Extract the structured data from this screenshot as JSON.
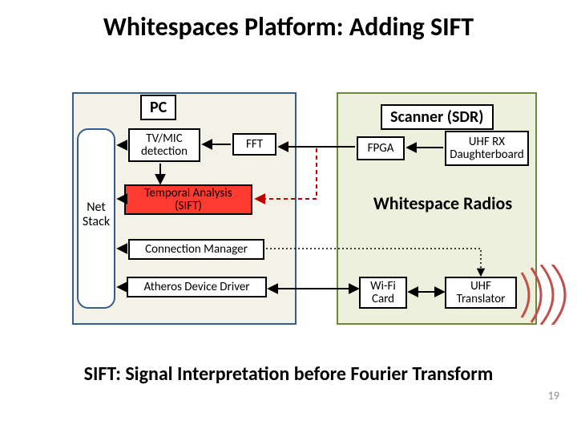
{
  "title": "Whitespaces Platform: Adding SIFT",
  "footer": "SIFT: Signal Interpretation before Fourier Transform",
  "page_number": "19",
  "pc": {
    "title": "PC",
    "net_stack_line1": "Net",
    "net_stack_line2": "Stack",
    "tvmic_line1": "TV/MIC",
    "tvmic_line2": "detection",
    "fft": "FFT",
    "sift_line1": "Temporal Analysis",
    "sift_line2": "(SIFT)",
    "connection_manager": "Connection Manager",
    "atheros_driver": "Atheros Device Driver"
  },
  "sdr": {
    "title": "Scanner (SDR)",
    "fpga": "FPGA",
    "uhf_rx_line1": "UHF RX",
    "uhf_rx_line2": "Daughterboard",
    "whitespace_radios": "Whitespace Radios",
    "wifi_line1": "Wi-Fi",
    "wifi_line2": "Card",
    "uhf_translator_line1": "UHF",
    "uhf_translator_line2": "Translator"
  },
  "colors": {
    "sift_fill": "#ff3b2f",
    "pc_border": "#385d8a",
    "sdr_border": "#6a8a3a",
    "wave": "#c0504d"
  }
}
